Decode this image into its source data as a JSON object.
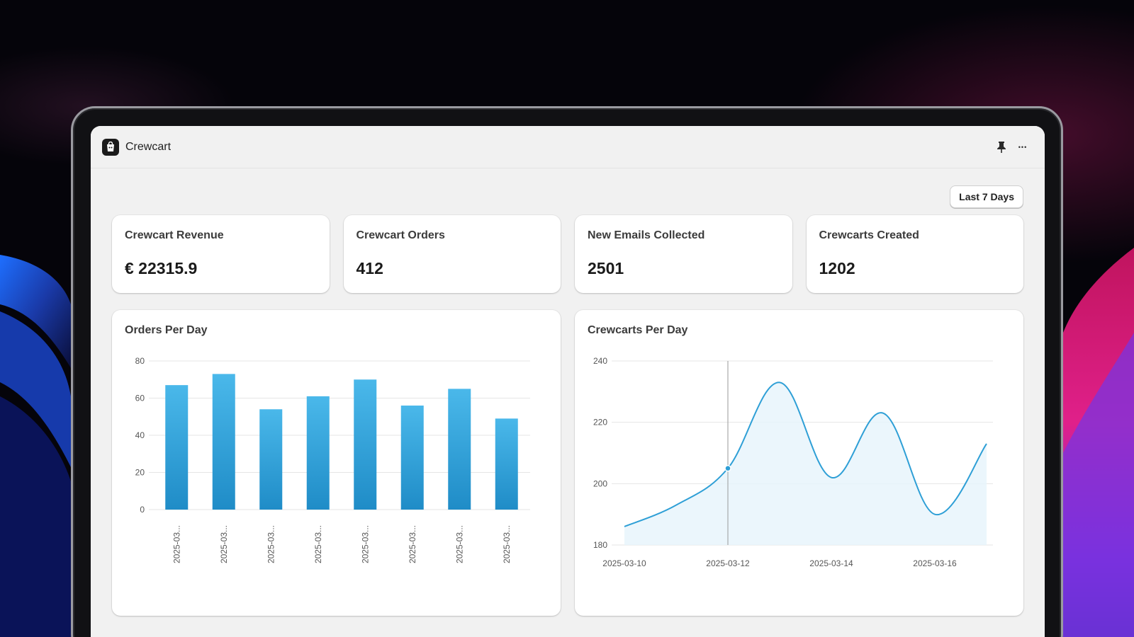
{
  "app": {
    "title": "Crewcart",
    "logo_icon": "shopping-bag-icon",
    "actions": [
      {
        "icon": "pin-icon"
      },
      {
        "icon": "more-horizontal-icon",
        "glyph": "•••"
      }
    ]
  },
  "date_range": {
    "label": "Last 7 Days"
  },
  "stats": [
    {
      "label": "Crewcart Revenue",
      "value": "€ 22315.9"
    },
    {
      "label": "Crewcart Orders",
      "value": "412"
    },
    {
      "label": "New Emails Collected",
      "value": "2501"
    },
    {
      "label": "Crewcarts Created",
      "value": "1202"
    }
  ],
  "colors": {
    "bar_top": "#4ab8ea",
    "bar_bottom": "#1f8cc7",
    "line": "#2e9fd6",
    "area": "#e6f4fb"
  },
  "chart_data": [
    {
      "type": "bar",
      "title": "Orders Per Day",
      "categories": [
        "2025-03...",
        "2025-03...",
        "2025-03...",
        "2025-03...",
        "2025-03...",
        "2025-03...",
        "2025-03...",
        "2025-03..."
      ],
      "values": [
        67,
        73,
        54,
        61,
        70,
        56,
        65,
        49
      ],
      "ylim": [
        0,
        80
      ],
      "yticks": [
        0,
        20,
        40,
        60,
        80
      ],
      "grid": true,
      "xlabel": "",
      "ylabel": ""
    },
    {
      "type": "line",
      "title": "Crewcarts Per Day",
      "x": [
        "2025-03-10",
        "2025-03-11",
        "2025-03-12",
        "2025-03-13",
        "2025-03-14",
        "2025-03-15",
        "2025-03-16",
        "2025-03-17"
      ],
      "values": [
        186,
        193,
        205,
        233,
        202,
        223,
        190,
        213
      ],
      "xticks": [
        "2025-03-10",
        "2025-03-12",
        "2025-03-14",
        "2025-03-16"
      ],
      "ylim": [
        180,
        240
      ],
      "yticks": [
        180,
        200,
        220,
        240
      ],
      "highlighted_point": "2025-03-12",
      "grid": true,
      "xlabel": "",
      "ylabel": ""
    }
  ]
}
